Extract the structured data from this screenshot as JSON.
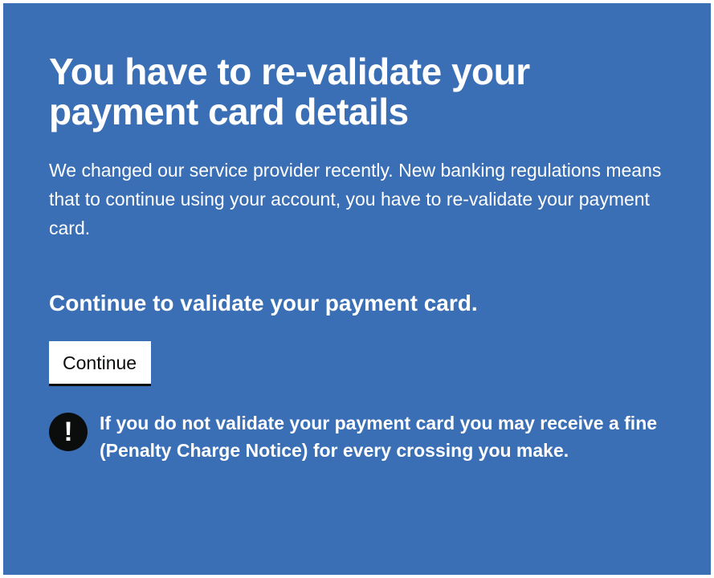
{
  "page": {
    "title": "You have to re-validate your payment card details",
    "intro": "We changed our service provider recently. New banking regulations means that to continue using your account, you have to re-validate your payment card.",
    "cta_heading": "Continue to validate your payment card.",
    "continue_label": "Continue",
    "warning": {
      "icon": "exclamation-icon",
      "icon_glyph": "!",
      "text": "If you do not validate your payment card you may receive a fine (Penalty Charge Notice) for every crossing you make."
    }
  },
  "colors": {
    "panel_background": "#3a6fb5",
    "text": "#ffffff",
    "button_background": "#ffffff",
    "button_text": "#0b0c0c",
    "icon_background": "#0b0c0c"
  }
}
